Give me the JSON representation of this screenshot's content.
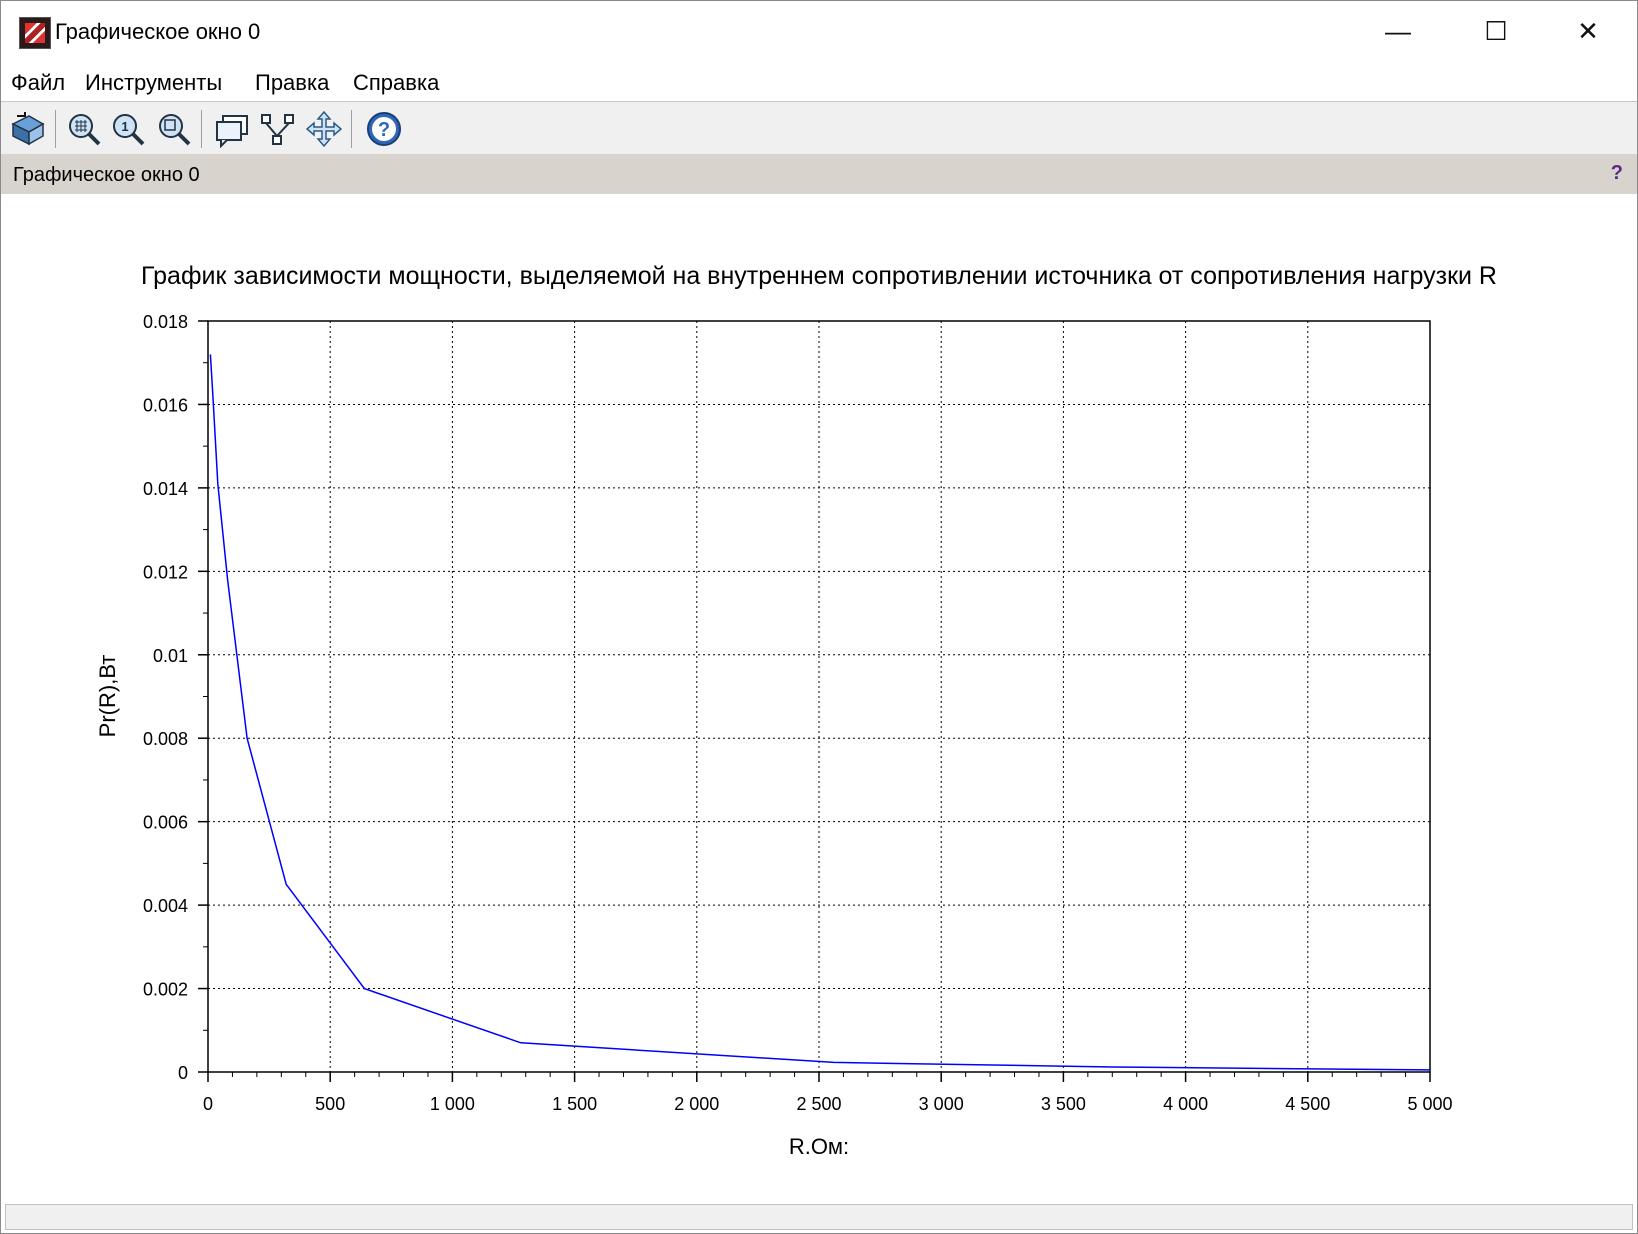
{
  "window": {
    "title": "Графическое окно 0",
    "icon": "scilab-app-icon",
    "minimize": "—",
    "maximize": "☐",
    "close": "✕"
  },
  "menu": {
    "items": [
      "Файл",
      "Инструменты",
      "Правка",
      "Справка"
    ]
  },
  "toolbar": {
    "buttons": [
      {
        "icon": "rotate-icon"
      },
      {
        "icon": "zoom-in-icon"
      },
      {
        "icon": "zoom-original-icon"
      },
      {
        "icon": "zoom-area-icon"
      },
      {
        "icon": "datatip-icon"
      },
      {
        "icon": "datatip-mode-icon"
      },
      {
        "icon": "pan-icon"
      },
      {
        "icon": "help-icon"
      }
    ]
  },
  "docbar": {
    "title": "Графическое окно 0",
    "help": "?"
  },
  "chart_data": {
    "type": "line",
    "title": "График зависимости мощности, выделяемой на внутреннем сопротивлении источника от сопротивления нагрузки R",
    "xlabel": "R.Ом:",
    "ylabel": "Pr(R),Вт",
    "xlim": [
      0,
      5000
    ],
    "ylim": [
      0,
      0.018
    ],
    "grid": true,
    "x_ticks": [
      0,
      500,
      1000,
      1500,
      2000,
      2500,
      3000,
      3500,
      4000,
      4500,
      5000
    ],
    "x_tick_labels": [
      "0",
      "500",
      "1 000",
      "1 500",
      "2 000",
      "2 500",
      "3 000",
      "3 500",
      "4 000",
      "4 500",
      "5 000"
    ],
    "y_ticks": [
      0,
      0.002,
      0.004,
      0.006,
      0.008,
      0.01,
      0.012,
      0.014,
      0.016,
      0.018
    ],
    "y_tick_labels": [
      "0",
      "0.002",
      "0.004",
      "0.006",
      "0.008",
      "0.01",
      "0.012",
      "0.014",
      "0.016",
      "0.018"
    ],
    "series": [
      {
        "color": "#0000ff",
        "x": [
          10,
          20,
          40,
          80,
          160,
          320,
          640,
          1280,
          2560,
          3700,
          4450,
          5000
        ],
        "y": [
          0.0172,
          0.0162,
          0.0141,
          0.0118,
          0.008,
          0.0045,
          0.002,
          0.0007,
          0.00023,
          0.00012,
          8e-05,
          5e-05
        ]
      }
    ]
  }
}
